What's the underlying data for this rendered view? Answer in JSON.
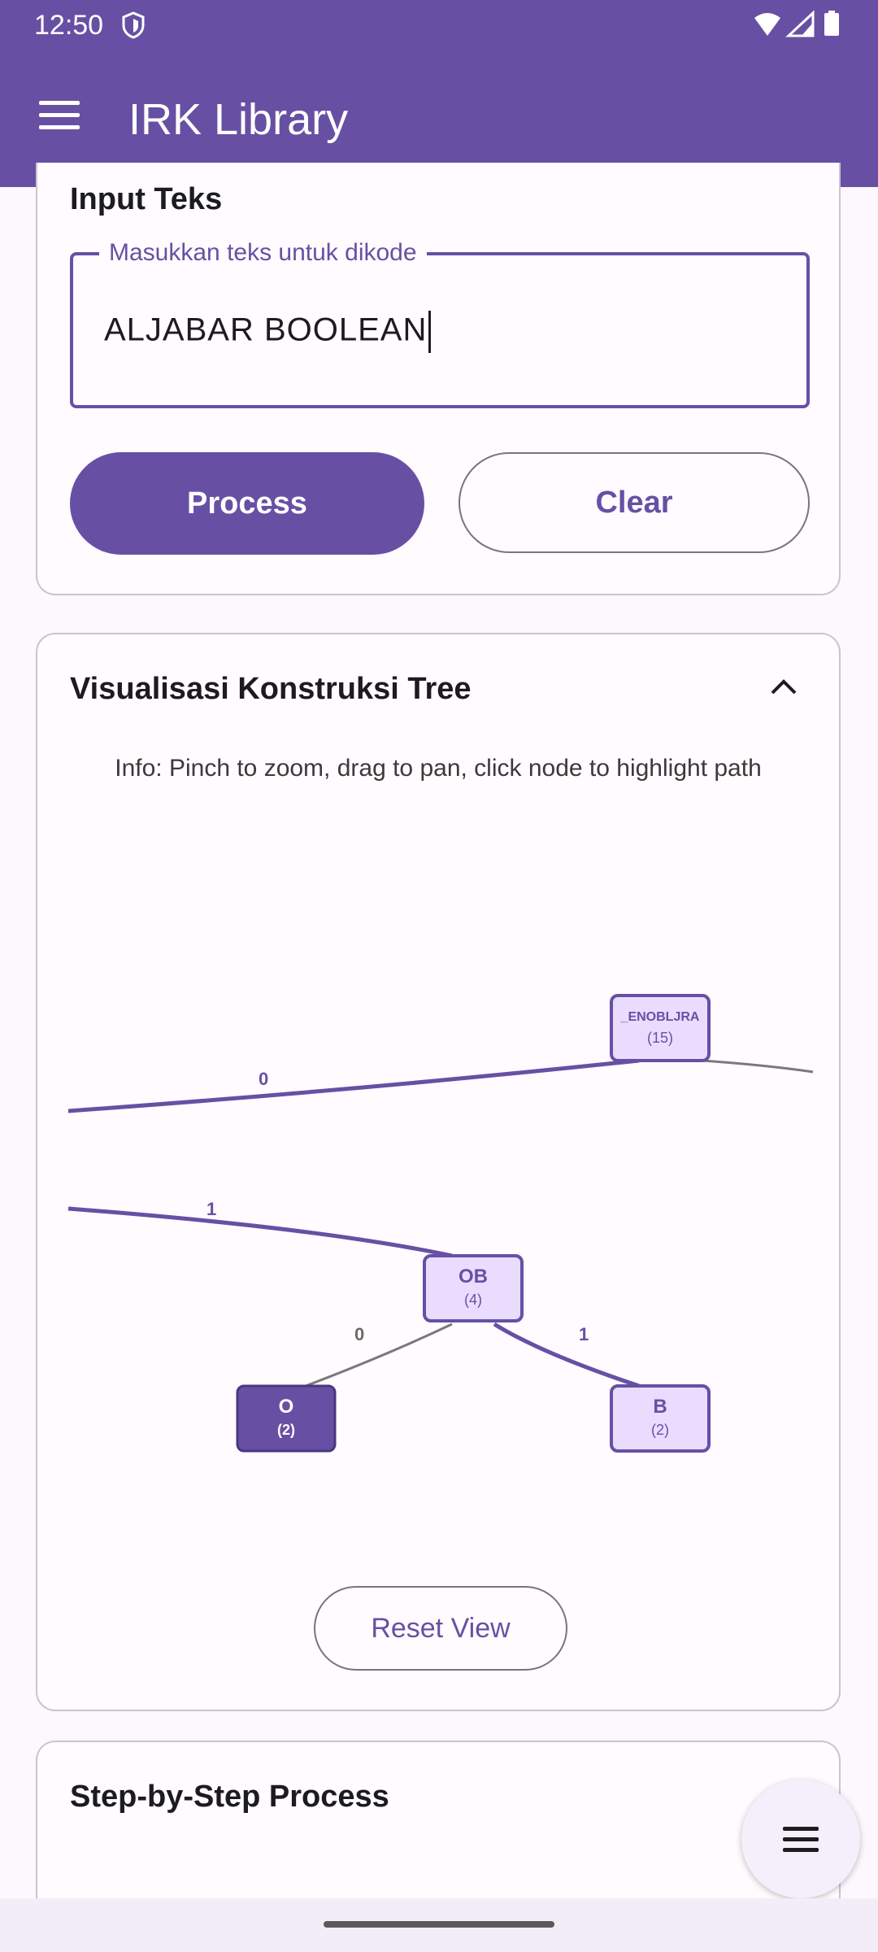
{
  "status": {
    "time": "12:50"
  },
  "app": {
    "title": "IRK Library"
  },
  "input_section": {
    "label": "Input Teks",
    "field_label": "Masukkan teks untuk dikode",
    "field_value": "ALJABAR BOOLEAN",
    "process_label": "Process",
    "clear_label": "Clear"
  },
  "tree_section": {
    "title": "Visualisasi Konstruksi Tree",
    "info": "Info: Pinch to zoom, drag to pan, click node to highlight path",
    "reset_label": "Reset View",
    "nodes": [
      {
        "id": "root",
        "label": "_ENOBLJRA",
        "count": "(15)"
      },
      {
        "id": "ob",
        "label": "OB",
        "count": "(4)"
      },
      {
        "id": "o",
        "label": "O",
        "count": "(2)",
        "selected": true
      },
      {
        "id": "b",
        "label": "B",
        "count": "(2)"
      }
    ],
    "edges": [
      {
        "label": "0"
      },
      {
        "label": "1"
      },
      {
        "label": "0"
      },
      {
        "label": "1"
      }
    ]
  },
  "steps_section": {
    "title": "Step-by-Step Process"
  },
  "colors": {
    "primary": "#6750a4",
    "node_fill": "#eadcff",
    "node_selected": "#6750a4"
  }
}
